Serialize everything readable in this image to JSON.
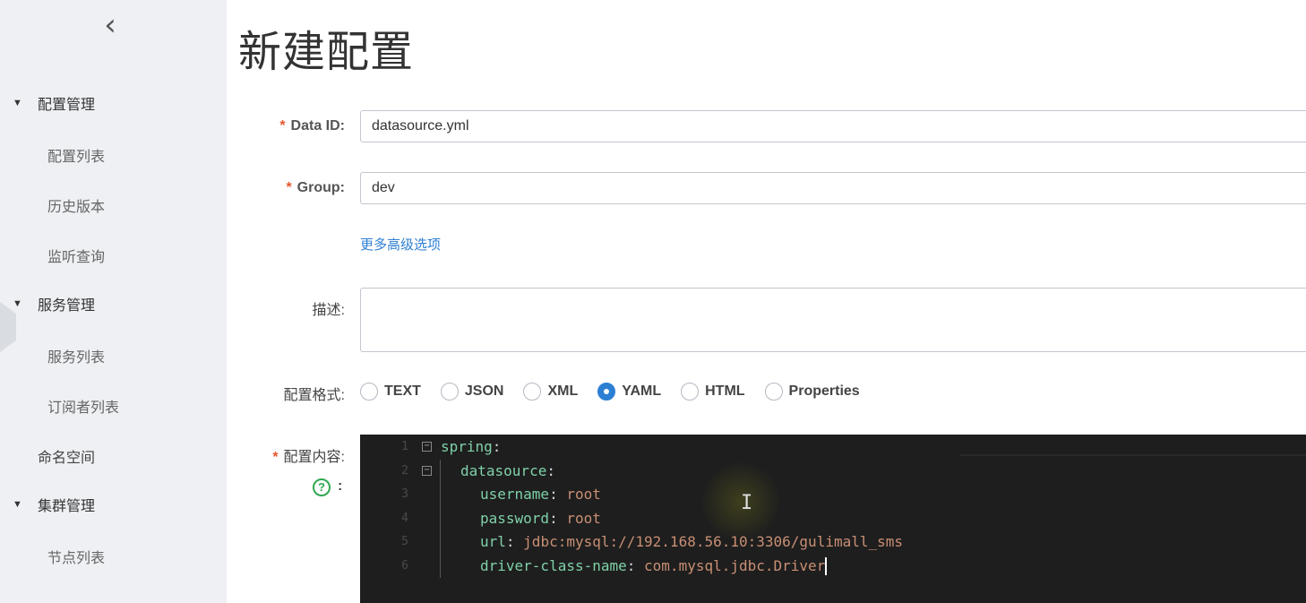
{
  "sidebar": {
    "collapse_icon": "‹",
    "groups": [
      {
        "label": "配置管理",
        "items": [
          "配置列表",
          "历史版本",
          "监听查询"
        ]
      },
      {
        "label": "服务管理",
        "items": [
          "服务列表",
          "订阅者列表"
        ]
      },
      {
        "label": "集群管理",
        "items": [
          "节点列表"
        ]
      }
    ],
    "namespace": "命名空间"
  },
  "page": {
    "title": "新建配置"
  },
  "form": {
    "data_id": {
      "label": "Data ID:",
      "value": "datasource.yml"
    },
    "group": {
      "label": "Group:",
      "value": "dev"
    },
    "advanced_link": "更多高级选项",
    "description": {
      "label": "描述:",
      "value": ""
    },
    "format": {
      "label": "配置格式:",
      "options": [
        "TEXT",
        "JSON",
        "XML",
        "YAML",
        "HTML",
        "Properties"
      ],
      "selected": "YAML"
    },
    "content": {
      "label": "配置内容:",
      "help_icon": "?",
      "help_colon": ":",
      "lines": [
        {
          "no": "1",
          "key": "spring",
          "sep": ":",
          "value": ""
        },
        {
          "no": "2",
          "key": "datasource",
          "sep": ":",
          "value": ""
        },
        {
          "no": "3",
          "key": "username",
          "sep": ": ",
          "value": "root"
        },
        {
          "no": "4",
          "key": "password",
          "sep": ": ",
          "value": "root"
        },
        {
          "no": "5",
          "key": "url",
          "sep": ": ",
          "value": "jdbc:mysql://192.168.56.10:3306/gulimall_sms"
        },
        {
          "no": "6",
          "key": "driver-class-name",
          "sep": ": ",
          "value": "com.mysql.jdbc.Driver"
        }
      ]
    }
  },
  "required_mark": "*"
}
